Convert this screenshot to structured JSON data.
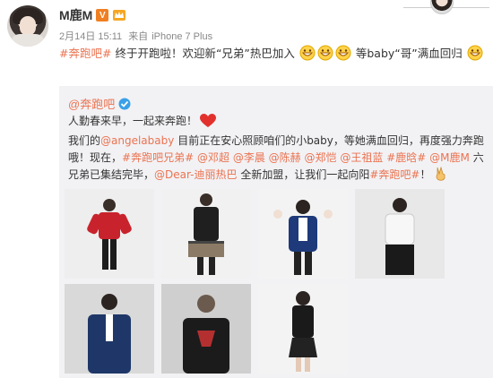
{
  "user": {
    "name": "M鹿M",
    "vip_badge": "V",
    "timestamp": "2月14日 15:11",
    "source_prefix": "来自",
    "device": "iPhone 7 Plus"
  },
  "post": {
    "tag": "#奔跑吧#",
    "text_part1": "终于开跑啦！欢迎新“兄弟”热巴加入",
    "text_part2": "等baby“哥”满血回归"
  },
  "repost": {
    "author": "@奔跑吧",
    "line1": "人勤春来早，一起来奔跑！",
    "body_p1": "我们的",
    "mention_angelababy": "@angelababy",
    "body_p2": "目前正在安心照顾咱们的小baby，等她满血回归，再度强力奔跑哦！现在，",
    "tag_brothers": "#奔跑吧兄弟#",
    "mention_dengchao": "@邓超",
    "mention_lichen": "@李晨",
    "mention_chenhe": "@陈赫",
    "mention_zhengkai": "@郑恺",
    "mention_wangzulan": "@王祖蓝",
    "tag_luhan": "#鹿晗#",
    "mention_luhan": "@M鹿M",
    "body_p3": "六兄弟已集结完毕，",
    "mention_reba": "@Dear-迪丽热巴",
    "body_p4": "全新加盟，让我们一起向阳",
    "tag_run": "#奔跑吧#",
    "body_p5": "！"
  },
  "colors": {
    "accent": "#eb7350",
    "repost_bg": "#f2f2f5",
    "meta": "#888888",
    "vip": "#f07f22"
  },
  "icons": [
    "crown-icon",
    "verified-icon",
    "heart-icon",
    "grin-emoji-icon",
    "victory-hand-icon"
  ]
}
